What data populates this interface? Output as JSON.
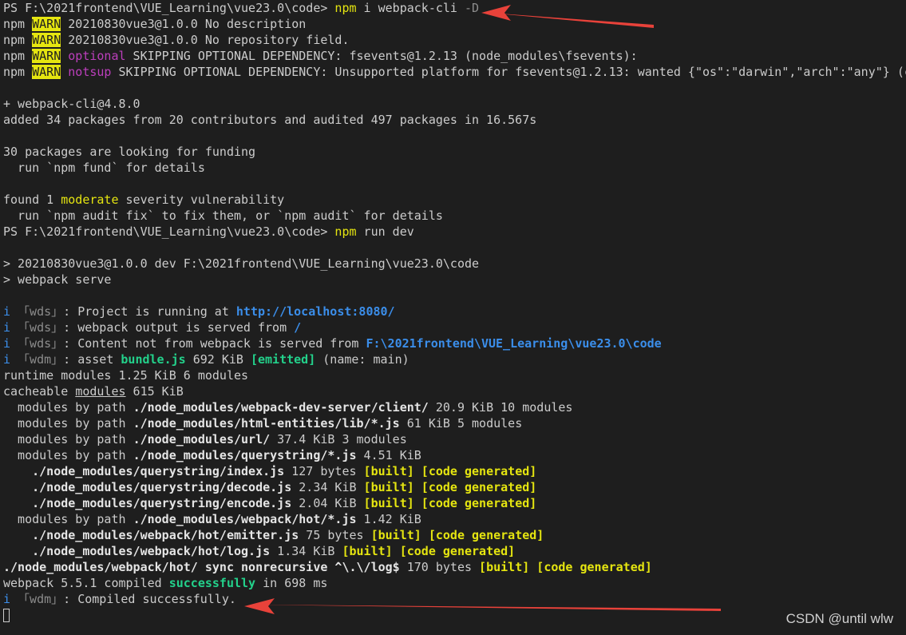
{
  "terminal": {
    "lines": [
      [
        {
          "t": "PS F:\\2021frontend\\VUE_Learning\\vue23.0\\code> "
        },
        {
          "t": "npm",
          "c": "c-yellow"
        },
        {
          "t": " i webpack-cli "
        },
        {
          "t": "-D",
          "c": "c-gray"
        }
      ],
      [
        {
          "t": "npm "
        },
        {
          "t": "WARN",
          "c": "warn"
        },
        {
          "t": " 20210830vue3@1.0.0 No description"
        }
      ],
      [
        {
          "t": "npm "
        },
        {
          "t": "WARN",
          "c": "warn"
        },
        {
          "t": " 20210830vue3@1.0.0 No repository field."
        }
      ],
      [
        {
          "t": "npm "
        },
        {
          "t": "WARN",
          "c": "warn"
        },
        {
          "t": " "
        },
        {
          "t": "optional",
          "c": "c-magenta"
        },
        {
          "t": " SKIPPING OPTIONAL DEPENDENCY: fsevents@1.2.13 (node_modules\\fsevents):"
        }
      ],
      [
        {
          "t": "npm "
        },
        {
          "t": "WARN",
          "c": "warn"
        },
        {
          "t": " "
        },
        {
          "t": "notsup",
          "c": "c-magenta"
        },
        {
          "t": " SKIPPING OPTIONAL DEPENDENCY: Unsupported platform for fsevents@1.2.13: wanted {\"os\":\"darwin\",\"arch\":\"any\"} (c"
        }
      ],
      [],
      [
        {
          "t": "+ webpack-cli@4.8.0"
        }
      ],
      [
        {
          "t": "added 34 packages from 20 contributors and audited 497 packages in 16.567s"
        }
      ],
      [],
      [
        {
          "t": "30 packages are looking for funding"
        }
      ],
      [
        {
          "t": "  run `npm fund` for details"
        }
      ],
      [],
      [
        {
          "t": "found 1 "
        },
        {
          "t": "moderate",
          "c": "c-yellow"
        },
        {
          "t": " severity vulnerability"
        }
      ],
      [
        {
          "t": "  run `npm audit fix` to fix them, or `npm audit` for details"
        }
      ],
      [
        {
          "t": "PS F:\\2021frontend\\VUE_Learning\\vue23.0\\code> "
        },
        {
          "t": "npm",
          "c": "c-yellow"
        },
        {
          "t": " run dev"
        }
      ],
      [],
      [
        {
          "t": "> 20210830vue3@1.0.0 dev F:\\2021frontend\\VUE_Learning\\vue23.0\\code"
        }
      ],
      [
        {
          "t": "> webpack serve"
        }
      ],
      [],
      [
        {
          "t": "i",
          "c": "c-blue"
        },
        {
          "t": " 「wds」",
          "c": "c-gray"
        },
        {
          "t": ": Project is running at "
        },
        {
          "t": "http://localhost:8080/",
          "c": "c-blue bold"
        }
      ],
      [
        {
          "t": "i",
          "c": "c-blue"
        },
        {
          "t": " 「wds」",
          "c": "c-gray"
        },
        {
          "t": ": webpack output is served from "
        },
        {
          "t": "/",
          "c": "c-blue bold"
        }
      ],
      [
        {
          "t": "i",
          "c": "c-blue"
        },
        {
          "t": " 「wds」",
          "c": "c-gray"
        },
        {
          "t": ": Content not from webpack is served from "
        },
        {
          "t": "F:\\2021frontend\\VUE_Learning\\vue23.0\\code",
          "c": "c-blue bold"
        }
      ],
      [
        {
          "t": "i",
          "c": "c-blue"
        },
        {
          "t": " 「wdm」",
          "c": "c-gray"
        },
        {
          "t": ": asset "
        },
        {
          "t": "bundle.js",
          "c": "c-green bold"
        },
        {
          "t": " 692 KiB "
        },
        {
          "t": "[emitted]",
          "c": "c-green bold"
        },
        {
          "t": " (name: main)"
        }
      ],
      [
        {
          "t": "runtime modules 1.25 KiB 6 modules"
        }
      ],
      [
        {
          "t": "cacheable "
        },
        {
          "t": "modules",
          "c": "under"
        },
        {
          "t": " 615 KiB"
        }
      ],
      [
        {
          "t": "  modules by path "
        },
        {
          "t": "./node_modules/webpack-dev-server/client/",
          "c": "c-white bold"
        },
        {
          "t": " 20.9 KiB 10 modules"
        }
      ],
      [
        {
          "t": "  modules by path "
        },
        {
          "t": "./node_modules/html-entities/lib/*.js",
          "c": "c-white bold"
        },
        {
          "t": " 61 KiB 5 modules"
        }
      ],
      [
        {
          "t": "  modules by path "
        },
        {
          "t": "./node_modules/url/",
          "c": "c-white bold"
        },
        {
          "t": " 37.4 KiB 3 modules"
        }
      ],
      [
        {
          "t": "  modules by path "
        },
        {
          "t": "./node_modules/querystring/*.js",
          "c": "c-white bold"
        },
        {
          "t": " 4.51 KiB"
        }
      ],
      [
        {
          "t": "    ./node_modules/querystring/index.js",
          "c": "c-white bold"
        },
        {
          "t": " 127 bytes "
        },
        {
          "t": "[built]",
          "c": "c-yellow bold"
        },
        {
          "t": " "
        },
        {
          "t": "[code generated]",
          "c": "c-yellow bold"
        }
      ],
      [
        {
          "t": "    ./node_modules/querystring/decode.js",
          "c": "c-white bold"
        },
        {
          "t": " 2.34 KiB "
        },
        {
          "t": "[built]",
          "c": "c-yellow bold"
        },
        {
          "t": " "
        },
        {
          "t": "[code generated]",
          "c": "c-yellow bold"
        }
      ],
      [
        {
          "t": "    ./node_modules/querystring/encode.js",
          "c": "c-white bold"
        },
        {
          "t": " 2.04 KiB "
        },
        {
          "t": "[built]",
          "c": "c-yellow bold"
        },
        {
          "t": " "
        },
        {
          "t": "[code generated]",
          "c": "c-yellow bold"
        }
      ],
      [
        {
          "t": "  modules by path "
        },
        {
          "t": "./node_modules/webpack/hot/*.js",
          "c": "c-white bold"
        },
        {
          "t": " 1.42 KiB"
        }
      ],
      [
        {
          "t": "    ./node_modules/webpack/hot/emitter.js",
          "c": "c-white bold"
        },
        {
          "t": " 75 bytes "
        },
        {
          "t": "[built]",
          "c": "c-yellow bold"
        },
        {
          "t": " "
        },
        {
          "t": "[code generated]",
          "c": "c-yellow bold"
        }
      ],
      [
        {
          "t": "    ./node_modules/webpack/hot/log.js",
          "c": "c-white bold"
        },
        {
          "t": " 1.34 KiB "
        },
        {
          "t": "[built]",
          "c": "c-yellow bold"
        },
        {
          "t": " "
        },
        {
          "t": "[code generated]",
          "c": "c-yellow bold"
        }
      ],
      [
        {
          "t": "./node_modules/webpack/hot/ sync nonrecursive ^\\.\\/log$",
          "c": "c-white bold"
        },
        {
          "t": " 170 bytes "
        },
        {
          "t": "[built]",
          "c": "c-yellow bold"
        },
        {
          "t": " "
        },
        {
          "t": "[code generated]",
          "c": "c-yellow bold"
        }
      ],
      [
        {
          "t": "webpack 5.5.1 compiled "
        },
        {
          "t": "successfully",
          "c": "c-green bold"
        },
        {
          "t": " in 698 ms"
        }
      ],
      [
        {
          "t": "i",
          "c": "c-blue"
        },
        {
          "t": " 「wdm」",
          "c": "c-gray"
        },
        {
          "t": ": Compiled successfully."
        }
      ]
    ]
  },
  "watermark": "CSDN @until wlw",
  "colors": {
    "background": "#1e1e1e",
    "foreground": "#cccccc",
    "annotation_arrow": "#e8423a"
  },
  "icons": {
    "cursor": "block-cursor"
  }
}
